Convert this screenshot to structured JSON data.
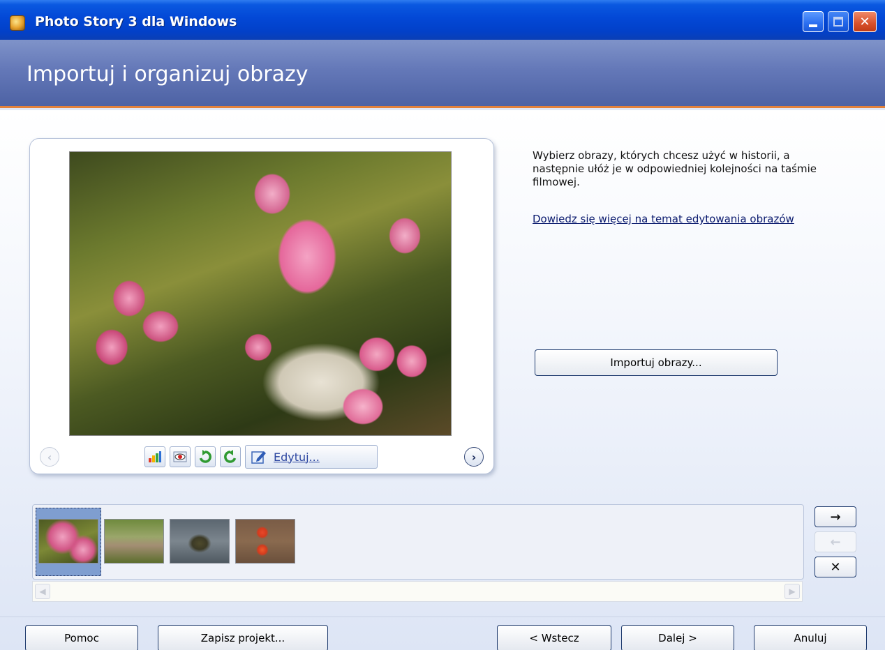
{
  "window": {
    "title": "Photo Story 3 dla Windows",
    "minimize_icon": "minimize-icon",
    "maximize_icon": "maximize-icon",
    "close_icon": "close-icon"
  },
  "header": {
    "title": "Importuj i organizuj obrazy"
  },
  "preview": {
    "toolbar": {
      "tools": [
        "auto-levels-icon",
        "red-eye-icon",
        "rotate-left-icon",
        "rotate-right-icon"
      ],
      "edit_label": "Edytuj..."
    }
  },
  "instructions": {
    "text": "Wybierz obrazy, których chcesz użyć w historii, a następnie ułóż je w odpowiedniej kolejności na taśmie filmowej.",
    "link": "Dowiedz się więcej na temat edytowania obrazów"
  },
  "import_button": "Importuj obrazy...",
  "filmstrip": {
    "thumbnails": [
      "magnolia-thumbnail",
      "meadow-thumbnail",
      "pond-thumbnail",
      "flowers-thumbnail"
    ],
    "selected_index": 0
  },
  "side_buttons": {
    "move_right": "→",
    "move_left": "←",
    "delete": "✕"
  },
  "footer": {
    "help": "Pomoc",
    "save": "Zapisz projekt...",
    "back": "< Wstecz",
    "next": "Dalej >",
    "cancel": "Anuluj"
  },
  "colors": {
    "title_bar": "#0348d6",
    "header_bg": "#6478b8",
    "header_accent": "#e2813c",
    "link": "#0a1a6e"
  }
}
